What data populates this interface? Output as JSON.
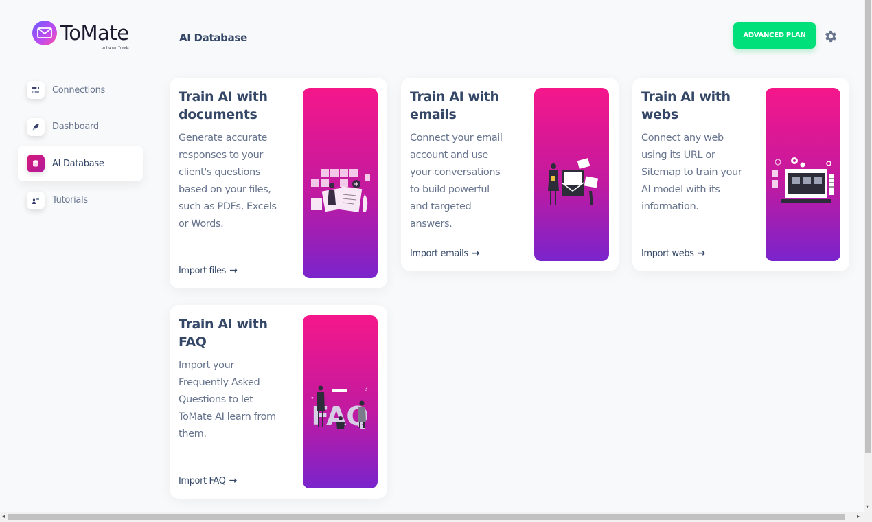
{
  "app": {
    "logo_text": "ToMate",
    "logo_sub": "by Human Trends"
  },
  "sidebar": {
    "items": [
      {
        "label": "Connections",
        "icon": "toggle-icon",
        "active": false
      },
      {
        "label": "Dashboard",
        "icon": "rocket-icon",
        "active": false
      },
      {
        "label": "AI Database",
        "icon": "database-icon",
        "active": true
      },
      {
        "label": "Tutorials",
        "icon": "teacher-icon",
        "active": false
      }
    ]
  },
  "header": {
    "title": "AI Database",
    "plan_button": "ADVANCED PLAN",
    "settings_icon": "gear-icon"
  },
  "cards": [
    {
      "title": "Train AI with documents",
      "description": "Generate accurate responses to your client's questions based on your files, such as PDFs, Excels or Words.",
      "link": "Import files",
      "illustration": "documents-illustration"
    },
    {
      "title": "Train AI with emails",
      "description": "Connect your email account and use your conversations to build powerful and targeted answers.",
      "link": "Import emails",
      "illustration": "emails-illustration"
    },
    {
      "title": "Train AI with webs",
      "description": "Connect any web using its URL or Sitemap to train your AI model with its information.",
      "link": "Import webs",
      "illustration": "webs-illustration"
    },
    {
      "title": "Train AI with FAQ",
      "description": "Import your Frequently Asked Questions to let ToMate AI learn from them.",
      "link": "Import FAQ",
      "illustration": "faq-illustration"
    }
  ],
  "colors": {
    "accent_green": "#00e07a",
    "gradient_top": "#f5178a",
    "gradient_bottom": "#7a24cc",
    "text_dark": "#344767",
    "text_muted": "#67748e"
  }
}
